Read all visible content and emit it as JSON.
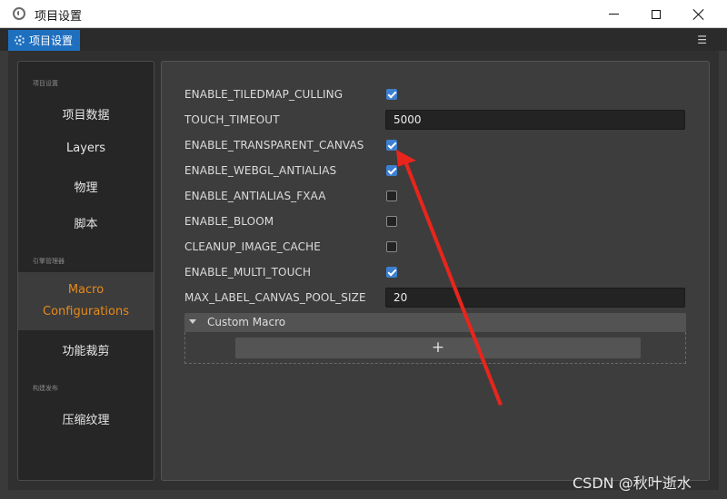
{
  "window": {
    "title": "项目设置"
  },
  "tab": {
    "label": "项目设置"
  },
  "sidebar": {
    "sections": [
      {
        "label": "项目设置"
      },
      {
        "label": "引擎管理器"
      },
      {
        "label": "构建发布"
      }
    ],
    "items": [
      {
        "label": "项目数据"
      },
      {
        "label": "Layers"
      },
      {
        "label": "物理"
      },
      {
        "label": "脚本"
      },
      {
        "label": "Macro",
        "label2": "Configurations",
        "active": true
      },
      {
        "label": "功能裁剪"
      },
      {
        "label": "压缩纹理"
      }
    ]
  },
  "macros": {
    "rows": [
      {
        "label": "ENABLE_TILEDMAP_CULLING",
        "checked": true
      },
      {
        "label": "TOUCH_TIMEOUT",
        "value": "5000"
      },
      {
        "label": "ENABLE_TRANSPARENT_CANVAS",
        "checked": true
      },
      {
        "label": "ENABLE_WEBGL_ANTIALIAS",
        "checked": true
      },
      {
        "label": "ENABLE_ANTIALIAS_FXAA",
        "checked": false
      },
      {
        "label": "ENABLE_BLOOM",
        "checked": false
      },
      {
        "label": "CLEANUP_IMAGE_CACHE",
        "checked": false
      },
      {
        "label": "ENABLE_MULTI_TOUCH",
        "checked": true
      },
      {
        "label": "MAX_LABEL_CANVAS_POOL_SIZE",
        "value": "20"
      }
    ],
    "custom": {
      "label": "Custom Macro",
      "add_label": "+"
    }
  },
  "watermark": "CSDN @秋叶逝水",
  "colors": {
    "accent": "#e88a1a",
    "tab": "#1f6fbf",
    "checkbox": "#3d7fd0",
    "annotation": "#e8251c"
  }
}
